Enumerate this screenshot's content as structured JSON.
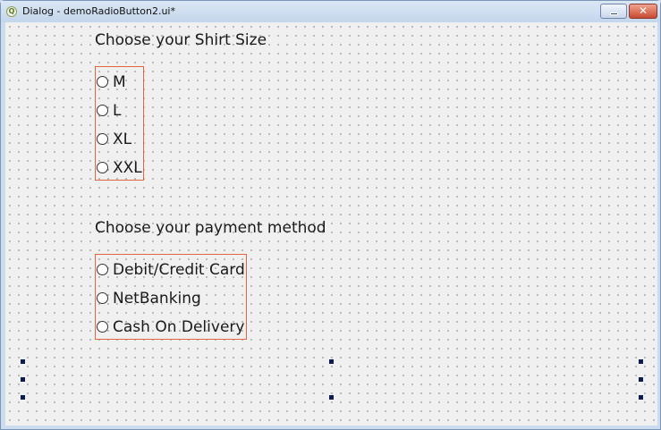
{
  "window": {
    "title": "Dialog - demoRadioButton2.ui*",
    "app_icon_glyph": "Q",
    "minimize_icon": "minimize-icon",
    "close_glyph": "✕"
  },
  "shirt": {
    "heading": "Choose your Shirt Size",
    "options": [
      "M",
      "L",
      "XL",
      "XXL"
    ]
  },
  "payment": {
    "heading": "Choose your payment method",
    "options": [
      "Debit/Credit Card",
      "NetBanking",
      "Cash On Delivery"
    ]
  },
  "colors": {
    "group_border": "#e0663e",
    "handle": "#0c1c4c"
  }
}
